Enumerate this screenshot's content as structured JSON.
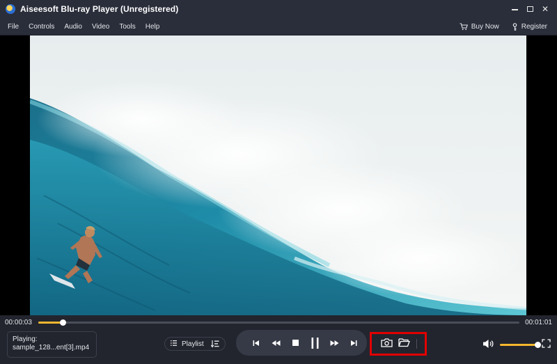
{
  "window": {
    "title": "Aiseesoft Blu-ray Player (Unregistered)",
    "minimize_label": "",
    "maximize_label": "",
    "close_label": "✕"
  },
  "menu": {
    "items": [
      {
        "label": "File"
      },
      {
        "label": "Controls"
      },
      {
        "label": "Audio"
      },
      {
        "label": "Video"
      },
      {
        "label": "Tools"
      },
      {
        "label": "Help"
      }
    ],
    "buy_now": "Buy Now",
    "register": "Register"
  },
  "player": {
    "current_time": "00:00:03",
    "duration": "00:01:01",
    "progress": 0.05,
    "volume": 0.92,
    "now_playing_label": "Playing:",
    "now_playing_file": "sample_128...ent[3].mp4",
    "playlist_label": "Playlist"
  },
  "icons": {
    "app": "app-logo-icon",
    "buy": "cart-icon",
    "register": "key-icon",
    "playlist": "list-icon",
    "sort": "sort-icon",
    "prev": "skip-previous-icon",
    "rewind": "rewind-icon",
    "stop": "stop-icon",
    "pause": "pause-icon",
    "forward": "fast-forward-icon",
    "next": "skip-next-icon",
    "snapshot": "camera-icon",
    "folder": "folder-icon",
    "volume": "volume-icon",
    "fullscreen": "fullscreen-icon"
  },
  "colors": {
    "accent": "#f4b72e",
    "highlight_box": "#e30000",
    "chrome": "#2a2e3a",
    "controls_bg": "#22252e"
  }
}
